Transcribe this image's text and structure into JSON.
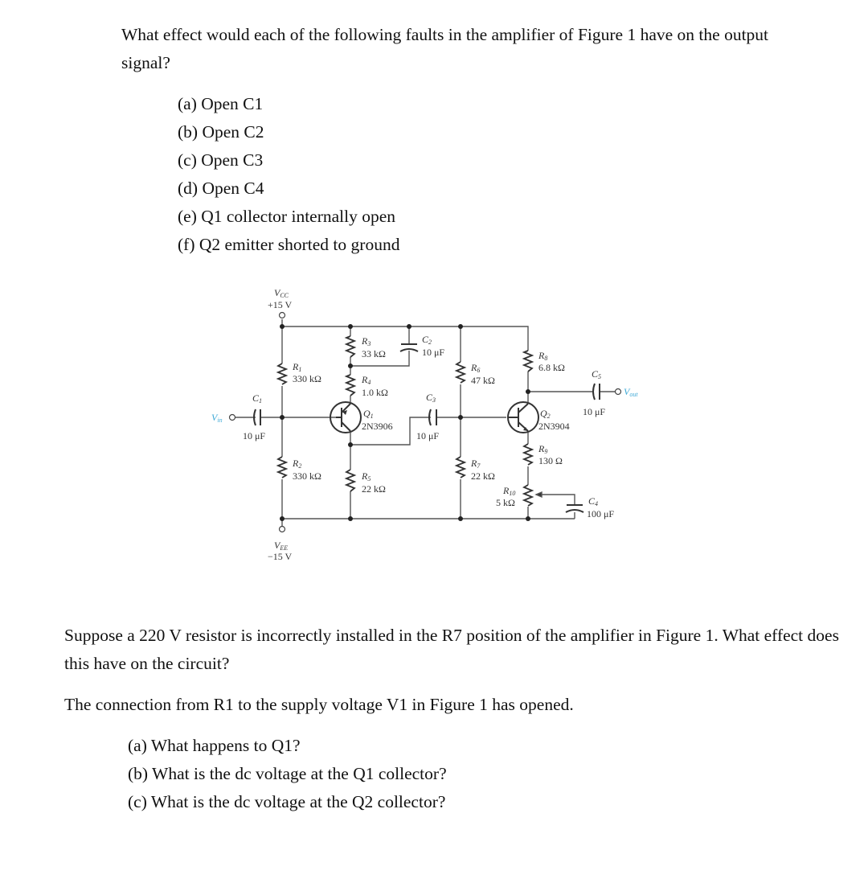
{
  "question1": {
    "prompt": "What effect would each of the following faults in the amplifier of Figure 1 have on the output signal?",
    "items": [
      "(a) Open C1",
      "(b) Open C2",
      "(c) Open C3",
      "(d) Open C4",
      "(e) Q1 collector internally open",
      "(f) Q2 emitter shorted to ground"
    ]
  },
  "figure": {
    "vcc": {
      "name": "V",
      "sub": "CC",
      "value": "+15 V"
    },
    "vee": {
      "name": "V",
      "sub": "EE",
      "value": "−15 V"
    },
    "vin": {
      "name": "V",
      "sub": "in"
    },
    "vout": {
      "name": "V",
      "sub": "out"
    },
    "wire_color": "#555555",
    "signal_label_color": "#3fa9d6",
    "components": {
      "R1": {
        "name": "R",
        "sub": "1",
        "value": "330 kΩ"
      },
      "R2": {
        "name": "R",
        "sub": "2",
        "value": "330 kΩ"
      },
      "R3": {
        "name": "R",
        "sub": "3",
        "value": "33 kΩ"
      },
      "R4": {
        "name": "R",
        "sub": "4",
        "value": "1.0 kΩ"
      },
      "R5": {
        "name": "R",
        "sub": "5",
        "value": "22 kΩ"
      },
      "R6": {
        "name": "R",
        "sub": "6",
        "value": "47 kΩ"
      },
      "R7": {
        "name": "R",
        "sub": "7",
        "value": "22 kΩ"
      },
      "R8": {
        "name": "R",
        "sub": "8",
        "value": "6.8 kΩ"
      },
      "R9": {
        "name": "R",
        "sub": "9",
        "value": "130 Ω"
      },
      "R10": {
        "name": "R",
        "sub": "10",
        "value": "5 kΩ"
      },
      "C1": {
        "name": "C",
        "sub": "1",
        "value": "10 μF"
      },
      "C2": {
        "name": "C",
        "sub": "2",
        "value": "10 μF"
      },
      "C3": {
        "name": "C",
        "sub": "3",
        "value": "10 μF"
      },
      "C4": {
        "name": "C",
        "sub": "4",
        "value": "100 μF"
      },
      "C5": {
        "name": "C",
        "sub": "5",
        "value": "10 μF"
      },
      "Q1": {
        "name": "Q",
        "sub": "1",
        "part": "2N3906",
        "type": "PNP"
      },
      "Q2": {
        "name": "Q",
        "sub": "2",
        "part": "2N3904",
        "type": "NPN"
      }
    }
  },
  "question2": {
    "prompt": "Suppose a 220 V resistor is incorrectly installed in the R7 position of the amplifier in Figure 1. What effect does this have on the circuit?"
  },
  "question3": {
    "prompt": "The connection from R1 to the supply voltage V1 in Figure 1 has opened.",
    "items": [
      "(a) What happens to Q1?",
      "(b) What is the dc voltage at the Q1 collector?",
      "(c) What is the dc voltage at the Q2 collector?"
    ]
  }
}
